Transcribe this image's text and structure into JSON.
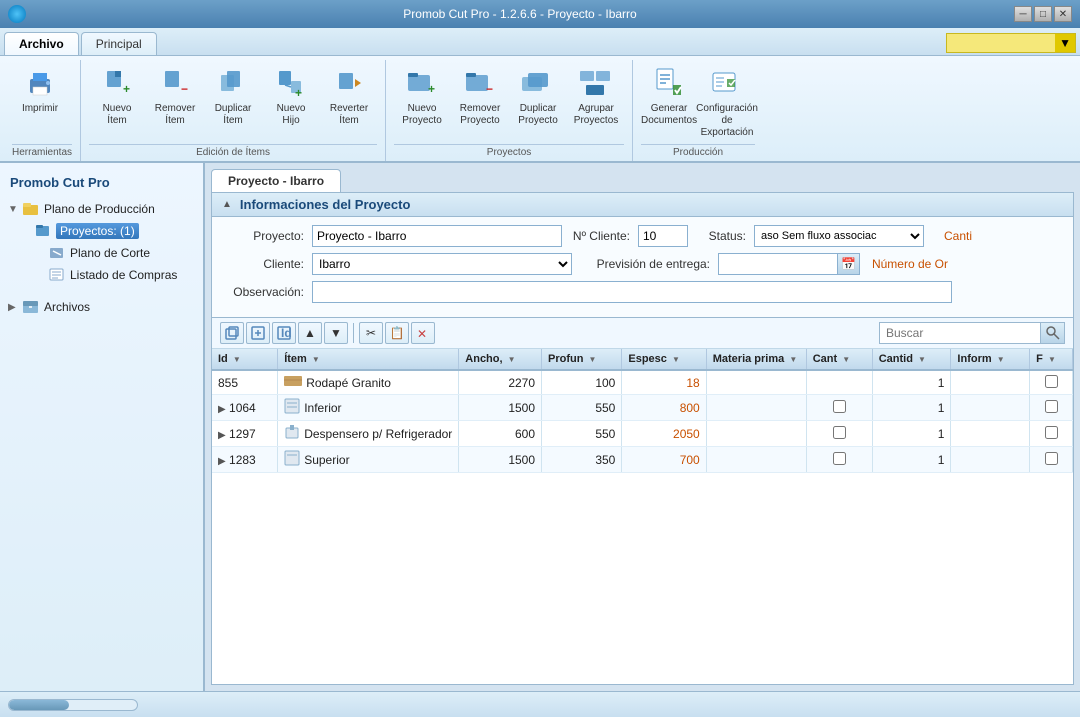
{
  "window": {
    "title": "Promob Cut Pro - 1.2.6.6 - Proyecto - Ibarro",
    "minimize": "─",
    "maximize": "□",
    "close": "✕"
  },
  "menu_tabs": [
    {
      "label": "Archivo",
      "active": true
    },
    {
      "label": "Principal",
      "active": false
    }
  ],
  "ribbon": {
    "search_placeholder": "",
    "groups": [
      {
        "label": "Herramientas",
        "buttons": [
          {
            "label": "Imprimir",
            "icon": "print"
          }
        ]
      },
      {
        "label": "Edición de Ítems",
        "buttons": [
          {
            "label": "Nuevo Ítem",
            "icon": "new-item"
          },
          {
            "label": "Remover Ítem",
            "icon": "remove-item"
          },
          {
            "label": "Duplicar Ítem",
            "icon": "duplicate-item"
          },
          {
            "label": "Nuevo Hijo",
            "icon": "new-child"
          },
          {
            "label": "Reverter Ítem",
            "icon": "revert-item"
          }
        ]
      },
      {
        "label": "Proyectos",
        "buttons": [
          {
            "label": "Nuevo Proyecto",
            "icon": "new-project"
          },
          {
            "label": "Remover Proyecto",
            "icon": "remove-project"
          },
          {
            "label": "Duplicar Proyecto",
            "icon": "duplicate-project"
          },
          {
            "label": "Agrupar Proyectos",
            "icon": "group-projects"
          }
        ]
      },
      {
        "label": "Producción",
        "buttons": [
          {
            "label": "Generar Documentos",
            "icon": "generate-docs"
          },
          {
            "label": "Configuración de Exportación",
            "icon": "export-config"
          }
        ]
      }
    ]
  },
  "sidebar": {
    "title": "Promob Cut Pro",
    "tree": [
      {
        "label": "Plano de Producción",
        "level": 0,
        "expanded": true,
        "icon": "folder"
      },
      {
        "label": "Proyectos: (1)",
        "level": 1,
        "selected": true,
        "icon": "projects"
      },
      {
        "label": "Plano de Corte",
        "level": 2,
        "icon": "cut-plan"
      },
      {
        "label": "Listado de Compras",
        "level": 2,
        "icon": "shopping-list"
      },
      {
        "label": "Archivos",
        "level": 0,
        "expanded": false,
        "icon": "archive"
      }
    ]
  },
  "content": {
    "tab_label": "Proyecto - Ibarro",
    "section_title": "Informaciones del Proyecto",
    "form": {
      "proyecto_label": "Proyecto:",
      "proyecto_value": "Proyecto - Ibarro",
      "cliente_label": "Cliente:",
      "cliente_value": "Ibarro",
      "observacion_label": "Observación:",
      "observacion_value": "",
      "no_cliente_label": "Nº Cliente:",
      "no_cliente_value": "10",
      "status_label": "Status:",
      "status_value": "aso Sem fluxo associac",
      "prevision_label": "Previsión de entrega:",
      "prevision_value": "",
      "numero_label": "Número de Or",
      "canti_label": "Canti"
    },
    "toolbar": {
      "search_placeholder": "Buscar"
    },
    "table": {
      "columns": [
        {
          "label": "Id",
          "filter": true
        },
        {
          "label": "Ítem",
          "filter": true
        },
        {
          "label": "Ancho,",
          "filter": true
        },
        {
          "label": "Profun",
          "filter": true
        },
        {
          "label": "Espesc",
          "filter": true
        },
        {
          "label": "Materia prima",
          "filter": true
        },
        {
          "label": "Cant",
          "filter": true
        },
        {
          "label": "Cantid",
          "filter": true
        },
        {
          "label": "Inform",
          "filter": true
        },
        {
          "label": "F",
          "filter": true
        }
      ],
      "rows": [
        {
          "id": "855",
          "expand": false,
          "item": "Rodapé Granito",
          "item_icon": "wood",
          "ancho": "2270",
          "profun": "100",
          "espesc": "18",
          "materia": "",
          "cant": "",
          "cantid": "1",
          "inform": "",
          "f": false
        },
        {
          "id": "1064",
          "expand": true,
          "item": "Inferior",
          "item_icon": "interior",
          "ancho": "1500",
          "profun": "550",
          "espesc": "800",
          "materia": "",
          "cant": "checkbox",
          "cantid": "1",
          "inform": "",
          "f": false
        },
        {
          "id": "1297",
          "expand": true,
          "item": "Despensero p/ Refrigerador",
          "item_icon": "shelf",
          "ancho": "600",
          "profun": "550",
          "espesc": "2050",
          "materia": "",
          "cant": "checkbox",
          "cantid": "1",
          "inform": "",
          "f": false
        },
        {
          "id": "1283",
          "expand": true,
          "item": "Superior",
          "item_icon": "top",
          "ancho": "1500",
          "profun": "350",
          "espesc": "700",
          "materia": "",
          "cant": "checkbox",
          "cantid": "1",
          "inform": "",
          "f": false
        }
      ]
    }
  }
}
